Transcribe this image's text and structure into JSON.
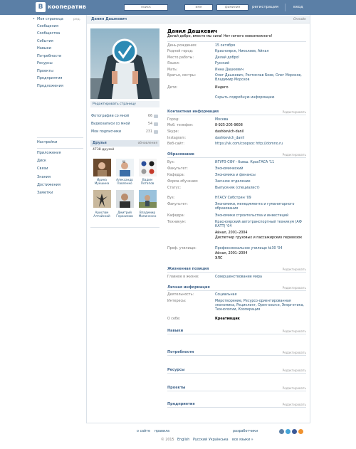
{
  "header": {
    "logo_letter": "B",
    "brand": "кооператив",
    "search_placeholder": "поиск",
    "first_name_placeholder": "имя",
    "last_name_placeholder": "фамилия",
    "register": "регистрация",
    "login": "вход"
  },
  "left_menu": {
    "group1": [
      {
        "label": "Моя страница",
        "extra": "ред."
      },
      {
        "label": "Сообщения"
      },
      {
        "label": "Сообщества"
      },
      {
        "label": "События"
      },
      {
        "label": "Навыки"
      },
      {
        "label": "Потребности"
      },
      {
        "label": "Ресурсы"
      },
      {
        "label": "Проекты"
      },
      {
        "label": "Предприятия"
      },
      {
        "label": "Предложения"
      }
    ],
    "group2": [
      {
        "label": "Настройки"
      }
    ],
    "group3": [
      {
        "label": "Приложения"
      },
      {
        "label": "Диск"
      },
      {
        "label": "Связи"
      },
      {
        "label": "Знания"
      },
      {
        "label": "Достижения"
      },
      {
        "label": "Заметки"
      }
    ]
  },
  "profile_bar": {
    "short_name": "Данил Дашкевич",
    "status_right": "Онлайн"
  },
  "profile": {
    "full_name": "Данил Дашкевич",
    "status": "Делай добро, вместе мы сила! Нет ничего невозможного!",
    "edit_page": "Редактировать страницу",
    "basic_rows": [
      {
        "label": "День рождения:",
        "value": "15 октября"
      },
      {
        "label": "Родной город:",
        "value": "Красноярск, Николаев, Айнал"
      },
      {
        "label": "Место работы:",
        "value": "Делай добро!"
      },
      {
        "label": "Языки:",
        "value": "Русский"
      },
      {
        "label": "Мать:",
        "value": "Инна Дашкевич"
      },
      {
        "label": "Братья, сестры:",
        "value": "Олег Дашкевич, Ростислав Боев, Олег Морозов, Владимир Морозов"
      },
      {
        "label": "Дети:",
        "value": "Индиго"
      }
    ],
    "hide_details": "Скрыть подробную информацию"
  },
  "left_column": {
    "photos_with_me": {
      "label": "Фотографии со мной",
      "count": "66"
    },
    "videos_with_me": {
      "label": "Видеозаписи со мной",
      "count": "54"
    },
    "subscribers": {
      "label": "Мои подписчики",
      "count": "231"
    },
    "friends_title": "Друзья",
    "friends_updated": "обновления",
    "friends_count": "4738 друзей",
    "friends": [
      {
        "first": "Ирина",
        "last": "Мукшина"
      },
      {
        "first": "Александр",
        "last": "Павленко"
      },
      {
        "first": "Вадим",
        "last": "Потапов"
      },
      {
        "first": "Арислам",
        "last": "Алтайский"
      },
      {
        "first": "Дмитрий",
        "last": "Герасимов"
      },
      {
        "first": "Владимир",
        "last": "Мапиненко"
      }
    ]
  },
  "sections": {
    "edit_label": "Редактировать",
    "contacts": {
      "title": "Контактная информация",
      "rows": [
        {
          "label": "Город:",
          "value": "Москва"
        },
        {
          "label": "Моб. телефон:",
          "value": "8-925-205-9608"
        },
        {
          "label": "Skype:",
          "value": "dashkevich-danil"
        },
        {
          "label": "Instagram:",
          "value": "dashkevich_danil"
        },
        {
          "label": "Веб-сайт:",
          "value": "https://vk.com/coopsoc http://domno.ru"
        }
      ]
    },
    "education": {
      "title": "Образование",
      "rows": [
        {
          "label": "Вуз:",
          "value": "ИГУРЭ СФУ - бывш. КрасГАСА '11"
        },
        {
          "label": "Факультет:",
          "value": "Экономический"
        },
        {
          "label": "Кафедра:",
          "value": "Экономика и финансы"
        },
        {
          "label": "Форма обучения:",
          "value": "Заочное отделение"
        },
        {
          "label": "Статус:",
          "value": "Выпускник (специалист)"
        },
        {
          "label": "Вуз:",
          "value": "НГАСУ Сибстрин '09"
        },
        {
          "label": "Факультет:",
          "value": "Экономики, менеджмента и гуманитарного образования"
        },
        {
          "label": "Кафедра:",
          "value": "Экономики строительства и инвестиций"
        },
        {
          "label": "Техникум:",
          "value": "Красноярский автотранспортный техникум (АФ КАТТ) '04"
        },
        {
          "label": "",
          "value": "Айнал, 2001–2004"
        },
        {
          "label": "",
          "value": "Диспетчер грузовых и пассажирских перевозок"
        },
        {
          "label": "Проф. училище:",
          "value": "Профессиональное училище №30 '04"
        },
        {
          "label": "",
          "value": "Айнал, 2001–2004"
        },
        {
          "label": "",
          "value": "ЭЛС"
        }
      ]
    },
    "life_position": {
      "title": "Жизненная позиция",
      "rows": [
        {
          "label": "Главное в жизни:",
          "value": "Совершенствование мира"
        }
      ]
    },
    "personal": {
      "title": "Личная информация",
      "rows": [
        {
          "label": "Деятельность:",
          "value": "Социальная"
        },
        {
          "label": "Интересы:",
          "value": "Миротворение, Ресурсо-ориентированная экономика, Рециклинг, Open-source, Энергетика, Технологии, Кооперация"
        },
        {
          "label": "О себе:",
          "value": "Креативщик"
        }
      ]
    },
    "extra": [
      {
        "title": "Навыки"
      },
      {
        "title": "Потребности"
      },
      {
        "title": "Ресурсы"
      },
      {
        "title": "Проекты"
      },
      {
        "title": "Предприятия"
      }
    ]
  },
  "footer": {
    "about": "о сайте",
    "rules": "правила",
    "developers": "разработчики",
    "copyright": "© 2015",
    "langs": [
      "English",
      "Русский",
      "Українська"
    ],
    "all_langs": "все языки »"
  },
  "colors": {
    "header_bg": "#5b7fa6",
    "link": "#2b587a",
    "section_title": "#45688e",
    "muted": "#777777"
  }
}
